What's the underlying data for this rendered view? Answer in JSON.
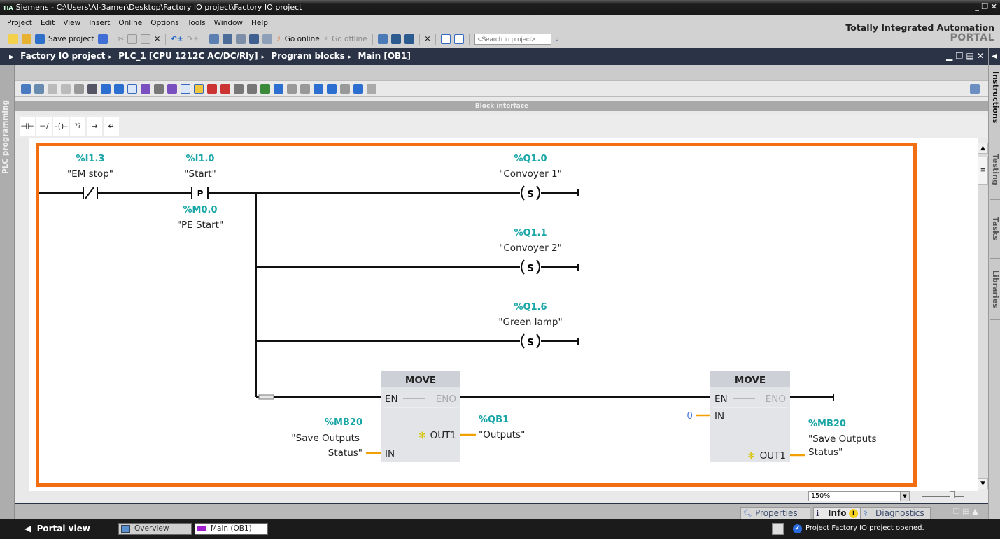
{
  "window": {
    "title": "Siemens  -  C:\\Users\\Al-3amer\\Desktop\\Factory IO project\\Factory IO project",
    "logo": "TIA"
  },
  "menu": [
    "Project",
    "Edit",
    "View",
    "Insert",
    "Online",
    "Options",
    "Tools",
    "Window",
    "Help"
  ],
  "toolbar": {
    "save_label": "Save project",
    "go_online": "Go online",
    "go_offline": "Go offline",
    "search_placeholder": "<Search in project>"
  },
  "brand": {
    "line1": "Totally Integrated Automation",
    "line2": "PORTAL"
  },
  "breadcrumb": [
    "Factory IO project",
    "PLC_1 [CPU 1212C AC/DC/Rly]",
    "Program blocks",
    "Main [OB1]"
  ],
  "left_panel": {
    "label": "PLC programming"
  },
  "right_tabs": [
    "Instructions",
    "Testing",
    "Tasks",
    "Libraries"
  ],
  "editor": {
    "block_interface_label": "Block interface"
  },
  "palette": [
    "⊣⊢",
    "⊣/⊢",
    "–()–",
    "??",
    "↦",
    "↵"
  ],
  "network": {
    "contacts": [
      {
        "address": "%I1.3",
        "symbol": "\"EM stop\"",
        "type": "NC"
      },
      {
        "address": "%I1.0",
        "symbol": "\"Start\"",
        "type": "P",
        "edge_address": "%M0.0",
        "edge_symbol": "\"PE Start\""
      }
    ],
    "coils": [
      {
        "address": "%Q1.0",
        "symbol": "\"Convoyer 1\"",
        "type": "S"
      },
      {
        "address": "%Q1.1",
        "symbol": "\"Convoyer 2\"",
        "type": "S"
      },
      {
        "address": "%Q1.6",
        "symbol": "\"Green lamp\"",
        "type": "S"
      }
    ],
    "move_blocks": [
      {
        "title": "MOVE",
        "en": "EN",
        "eno": "ENO",
        "in_label": "IN",
        "out_label": "OUT1",
        "in_address": "%MB20",
        "in_symbol_1": "\"Save Outputs",
        "in_symbol_2": "Status\"",
        "out_address": "%QB1",
        "out_symbol": "\"Outputs\""
      },
      {
        "title": "MOVE",
        "en": "EN",
        "eno": "ENO",
        "in_label": "IN",
        "out_label": "OUT1",
        "in_value": "0",
        "out_address": "%MB20",
        "out_symbol_1": "\"Save Outputs",
        "out_symbol_2": "Status\""
      }
    ],
    "coil_letter": "S",
    "edge_letter": "P"
  },
  "zoom": {
    "value": "150%"
  },
  "inspector_tabs": [
    "Properties",
    "Info",
    "Diagnostics"
  ],
  "statusbar": {
    "portal_view": "Portal view",
    "tabs": [
      "Overview",
      "Main (OB1)"
    ],
    "message": "Project Factory IO project opened."
  }
}
